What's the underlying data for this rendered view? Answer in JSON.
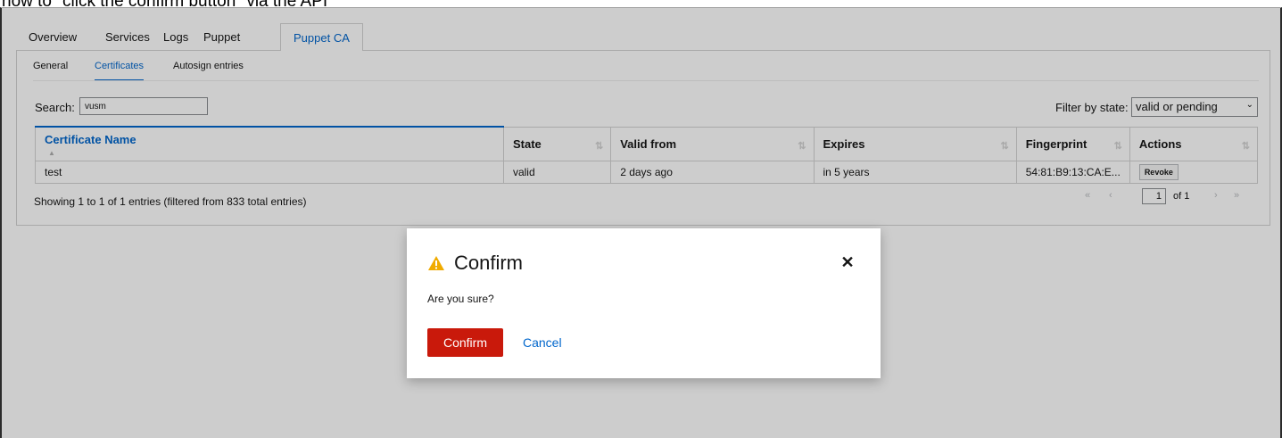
{
  "caption": "how to \"click the confirm button\" via the API",
  "tabs": [
    {
      "label": "Overview",
      "active": false
    },
    {
      "label": "Services",
      "active": false
    },
    {
      "label": "Logs",
      "active": false
    },
    {
      "label": "Puppet",
      "active": false
    },
    {
      "label": "Puppet CA",
      "active": true
    }
  ],
  "subtabs": [
    {
      "label": "General",
      "active": false
    },
    {
      "label": "Certificates",
      "active": true
    },
    {
      "label": "Autosign entries",
      "active": false
    }
  ],
  "search": {
    "label": "Search:",
    "value": "vusm"
  },
  "filter": {
    "label": "Filter by state:",
    "selected": "valid or pending",
    "chevron_icon": "chevron-down-icon"
  },
  "table": {
    "columns": [
      "Certificate Name",
      "State",
      "Valid from",
      "Expires",
      "Fingerprint",
      "Actions"
    ],
    "sorted_column": "Certificate Name",
    "rows": [
      {
        "name": "test",
        "state": "valid",
        "valid_from": "2 days ago",
        "expires": "in 5 years",
        "fingerprint": "54:81:B9:13:CA:E...",
        "action": "Revoke"
      }
    ]
  },
  "footer": {
    "entries_text": "Showing 1 to 1 of 1 entries (filtered from 833 total entries)",
    "page_value": "1",
    "page_of": "of 1",
    "nav_icons": [
      "first-page-icon",
      "prev-page-icon",
      "next-page-icon",
      "last-page-icon"
    ]
  },
  "modal": {
    "title": "Confirm",
    "icon": "warning-icon",
    "icon_color": "#f0ab00",
    "body": "Are you sure?",
    "confirm_label": "Confirm",
    "cancel_label": "Cancel",
    "confirm_color": "#c9190b",
    "link_color": "#0066cc"
  }
}
